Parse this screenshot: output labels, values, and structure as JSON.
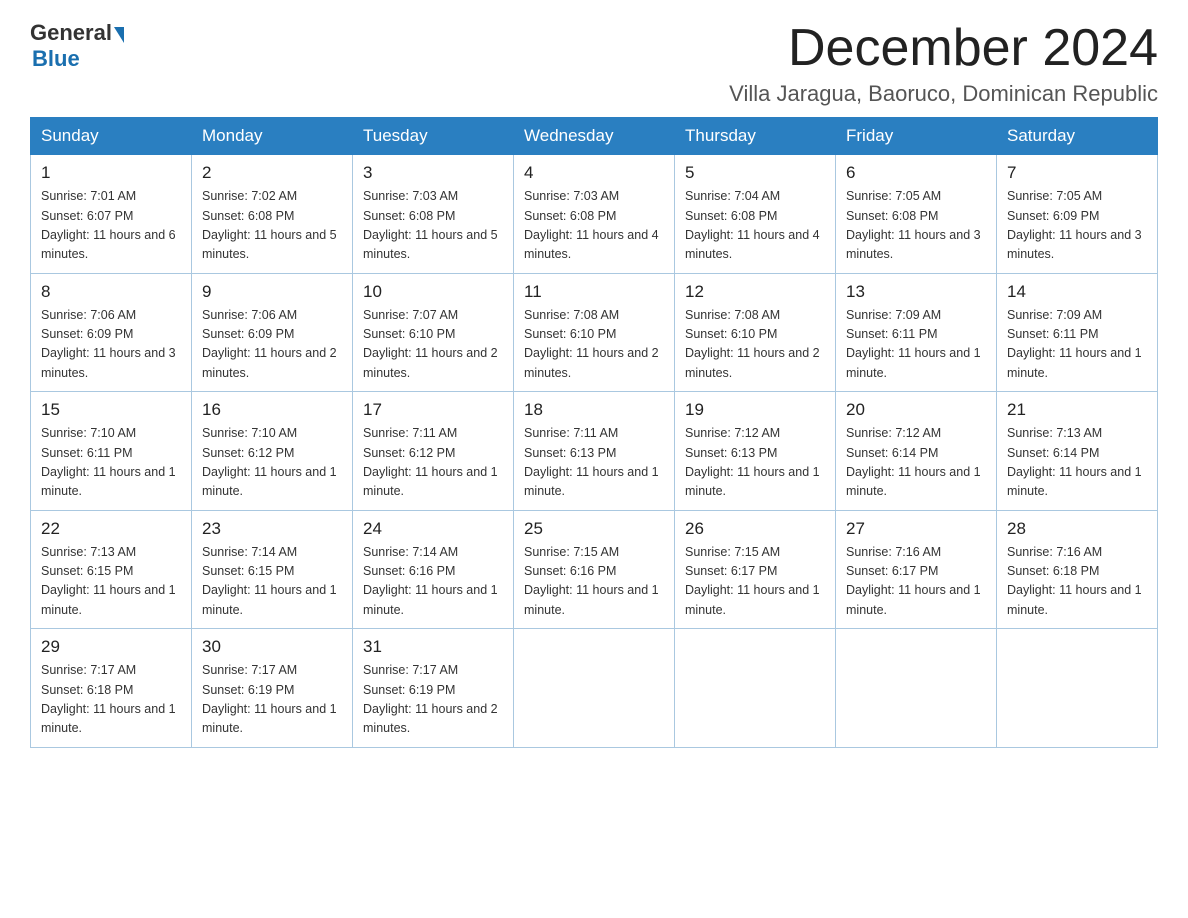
{
  "header": {
    "logo": {
      "general": "General",
      "triangle": "▶",
      "blue": "Blue"
    },
    "title": "December 2024",
    "location": "Villa Jaragua, Baoruco, Dominican Republic"
  },
  "calendar": {
    "days_of_week": [
      "Sunday",
      "Monday",
      "Tuesday",
      "Wednesday",
      "Thursday",
      "Friday",
      "Saturday"
    ],
    "weeks": [
      [
        {
          "day": "1",
          "sunrise": "Sunrise: 7:01 AM",
          "sunset": "Sunset: 6:07 PM",
          "daylight": "Daylight: 11 hours and 6 minutes."
        },
        {
          "day": "2",
          "sunrise": "Sunrise: 7:02 AM",
          "sunset": "Sunset: 6:08 PM",
          "daylight": "Daylight: 11 hours and 5 minutes."
        },
        {
          "day": "3",
          "sunrise": "Sunrise: 7:03 AM",
          "sunset": "Sunset: 6:08 PM",
          "daylight": "Daylight: 11 hours and 5 minutes."
        },
        {
          "day": "4",
          "sunrise": "Sunrise: 7:03 AM",
          "sunset": "Sunset: 6:08 PM",
          "daylight": "Daylight: 11 hours and 4 minutes."
        },
        {
          "day": "5",
          "sunrise": "Sunrise: 7:04 AM",
          "sunset": "Sunset: 6:08 PM",
          "daylight": "Daylight: 11 hours and 4 minutes."
        },
        {
          "day": "6",
          "sunrise": "Sunrise: 7:05 AM",
          "sunset": "Sunset: 6:08 PM",
          "daylight": "Daylight: 11 hours and 3 minutes."
        },
        {
          "day": "7",
          "sunrise": "Sunrise: 7:05 AM",
          "sunset": "Sunset: 6:09 PM",
          "daylight": "Daylight: 11 hours and 3 minutes."
        }
      ],
      [
        {
          "day": "8",
          "sunrise": "Sunrise: 7:06 AM",
          "sunset": "Sunset: 6:09 PM",
          "daylight": "Daylight: 11 hours and 3 minutes."
        },
        {
          "day": "9",
          "sunrise": "Sunrise: 7:06 AM",
          "sunset": "Sunset: 6:09 PM",
          "daylight": "Daylight: 11 hours and 2 minutes."
        },
        {
          "day": "10",
          "sunrise": "Sunrise: 7:07 AM",
          "sunset": "Sunset: 6:10 PM",
          "daylight": "Daylight: 11 hours and 2 minutes."
        },
        {
          "day": "11",
          "sunrise": "Sunrise: 7:08 AM",
          "sunset": "Sunset: 6:10 PM",
          "daylight": "Daylight: 11 hours and 2 minutes."
        },
        {
          "day": "12",
          "sunrise": "Sunrise: 7:08 AM",
          "sunset": "Sunset: 6:10 PM",
          "daylight": "Daylight: 11 hours and 2 minutes."
        },
        {
          "day": "13",
          "sunrise": "Sunrise: 7:09 AM",
          "sunset": "Sunset: 6:11 PM",
          "daylight": "Daylight: 11 hours and 1 minute."
        },
        {
          "day": "14",
          "sunrise": "Sunrise: 7:09 AM",
          "sunset": "Sunset: 6:11 PM",
          "daylight": "Daylight: 11 hours and 1 minute."
        }
      ],
      [
        {
          "day": "15",
          "sunrise": "Sunrise: 7:10 AM",
          "sunset": "Sunset: 6:11 PM",
          "daylight": "Daylight: 11 hours and 1 minute."
        },
        {
          "day": "16",
          "sunrise": "Sunrise: 7:10 AM",
          "sunset": "Sunset: 6:12 PM",
          "daylight": "Daylight: 11 hours and 1 minute."
        },
        {
          "day": "17",
          "sunrise": "Sunrise: 7:11 AM",
          "sunset": "Sunset: 6:12 PM",
          "daylight": "Daylight: 11 hours and 1 minute."
        },
        {
          "day": "18",
          "sunrise": "Sunrise: 7:11 AM",
          "sunset": "Sunset: 6:13 PM",
          "daylight": "Daylight: 11 hours and 1 minute."
        },
        {
          "day": "19",
          "sunrise": "Sunrise: 7:12 AM",
          "sunset": "Sunset: 6:13 PM",
          "daylight": "Daylight: 11 hours and 1 minute."
        },
        {
          "day": "20",
          "sunrise": "Sunrise: 7:12 AM",
          "sunset": "Sunset: 6:14 PM",
          "daylight": "Daylight: 11 hours and 1 minute."
        },
        {
          "day": "21",
          "sunrise": "Sunrise: 7:13 AM",
          "sunset": "Sunset: 6:14 PM",
          "daylight": "Daylight: 11 hours and 1 minute."
        }
      ],
      [
        {
          "day": "22",
          "sunrise": "Sunrise: 7:13 AM",
          "sunset": "Sunset: 6:15 PM",
          "daylight": "Daylight: 11 hours and 1 minute."
        },
        {
          "day": "23",
          "sunrise": "Sunrise: 7:14 AM",
          "sunset": "Sunset: 6:15 PM",
          "daylight": "Daylight: 11 hours and 1 minute."
        },
        {
          "day": "24",
          "sunrise": "Sunrise: 7:14 AM",
          "sunset": "Sunset: 6:16 PM",
          "daylight": "Daylight: 11 hours and 1 minute."
        },
        {
          "day": "25",
          "sunrise": "Sunrise: 7:15 AM",
          "sunset": "Sunset: 6:16 PM",
          "daylight": "Daylight: 11 hours and 1 minute."
        },
        {
          "day": "26",
          "sunrise": "Sunrise: 7:15 AM",
          "sunset": "Sunset: 6:17 PM",
          "daylight": "Daylight: 11 hours and 1 minute."
        },
        {
          "day": "27",
          "sunrise": "Sunrise: 7:16 AM",
          "sunset": "Sunset: 6:17 PM",
          "daylight": "Daylight: 11 hours and 1 minute."
        },
        {
          "day": "28",
          "sunrise": "Sunrise: 7:16 AM",
          "sunset": "Sunset: 6:18 PM",
          "daylight": "Daylight: 11 hours and 1 minute."
        }
      ],
      [
        {
          "day": "29",
          "sunrise": "Sunrise: 7:17 AM",
          "sunset": "Sunset: 6:18 PM",
          "daylight": "Daylight: 11 hours and 1 minute."
        },
        {
          "day": "30",
          "sunrise": "Sunrise: 7:17 AM",
          "sunset": "Sunset: 6:19 PM",
          "daylight": "Daylight: 11 hours and 1 minute."
        },
        {
          "day": "31",
          "sunrise": "Sunrise: 7:17 AM",
          "sunset": "Sunset: 6:19 PM",
          "daylight": "Daylight: 11 hours and 2 minutes."
        },
        null,
        null,
        null,
        null
      ]
    ]
  }
}
